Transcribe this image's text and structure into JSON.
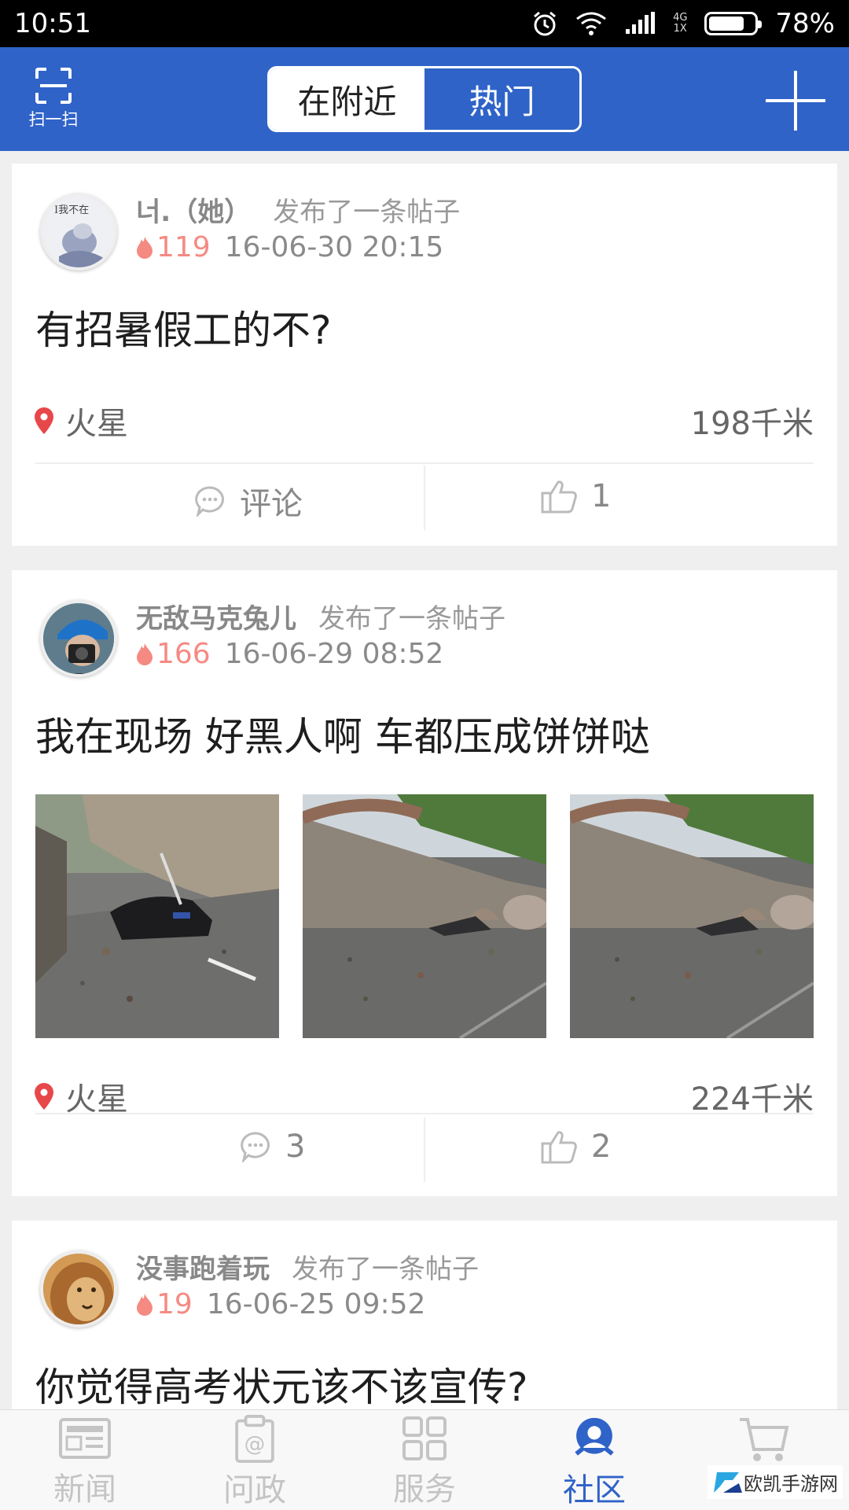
{
  "status_bar": {
    "time": "10:51",
    "network_top": "4G",
    "network_bottom": "1X",
    "battery": "78%",
    "battery_level": 0.78
  },
  "header": {
    "scan_label": "扫一扫",
    "tabs": [
      {
        "label": "在附近"
      },
      {
        "label": "热门"
      }
    ]
  },
  "posts": [
    {
      "username": "너.（她）",
      "action": "发布了一条帖子",
      "heat": "119",
      "timestamp": "16-06-30 20:15",
      "title": "有招暑假工的不?",
      "location": "火星",
      "distance": "198千米",
      "comment_label": "评论",
      "likes": "1"
    },
    {
      "username": "无敌马克兔儿",
      "action": "发布了一条帖子",
      "heat": "166",
      "timestamp": "16-06-29 08:52",
      "title": "我在现场 好黑人啊 车都压成饼饼哒",
      "location": "火星",
      "distance": "224千米",
      "comments": "3",
      "likes": "2"
    },
    {
      "username": "没事跑着玩",
      "action": "发布了一条帖子",
      "heat": "19",
      "timestamp": "16-06-25 09:52",
      "title": "你觉得高考状元该不该宣传?"
    }
  ],
  "avatar_1_text": "I我不在",
  "bottom_nav": [
    {
      "label": "新闻",
      "icon": "news-icon"
    },
    {
      "label": "问政",
      "icon": "clipboard-at-icon"
    },
    {
      "label": "服务",
      "icon": "grid-icon"
    },
    {
      "label": "社区",
      "icon": "community-icon"
    },
    {
      "label": "",
      "icon": "cart-icon"
    }
  ],
  "watermark": "欧凯手游网",
  "colors": {
    "brand": "#2f63c8",
    "heat": "#f58a83",
    "pin": "#e8474a"
  }
}
